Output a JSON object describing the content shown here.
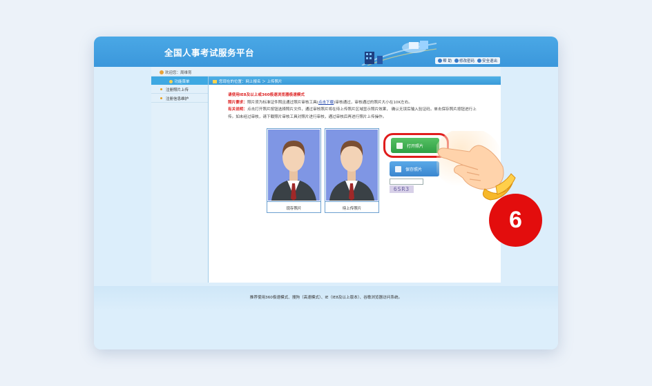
{
  "header": {
    "site_title": "全国人事考试服务平台",
    "links": [
      "帮 助",
      "修改密码",
      "安全退出"
    ]
  },
  "welcome": "欢迎您：周维育",
  "sidebar": {
    "title": "功能菜单",
    "items": [
      {
        "label": "注册照片上传"
      },
      {
        "label": "注册信息维护"
      }
    ]
  },
  "breadcrumb": "您现在的位置：网上报名 ＞ 上传照片",
  "notice": {
    "line1": "请使用IE8及以上或360极速浏览器极速模式",
    "req_label": "照片要求：",
    "req_text_a": "照片须为标准证件照且通过照片审核工具(",
    "req_link": "点击下载",
    "req_text_b": ")审核通过，审核通过的照片大小在10K左右。",
    "note_label": "有关说明：",
    "note_text": "点击打开照片按钮选择照片文件，通过审核照片将在待上传照片区域显示照片效果， 确认无误后输入验证码，单击保存照片按钮进行上传。如未经过审核，请下载照片审核工具对照片进行审核，通过审核后再进行照片上传操作。"
  },
  "photos": [
    {
      "caption": "现存照片"
    },
    {
      "caption": "待上传照片"
    }
  ],
  "buttons": {
    "open": "打开照片",
    "save": "保存照片"
  },
  "captcha": "6SR3",
  "footer": "推荐使用360极速模式、搜狗（高速模式）、IE（IE8及以上版本）、谷歌浏览器访问系统。",
  "step_badge": "6",
  "colors": {
    "accent": "#3b97db",
    "open_button": "#2f9f45",
    "save_button": "#3a86cf",
    "badge": "#e30d0d"
  }
}
